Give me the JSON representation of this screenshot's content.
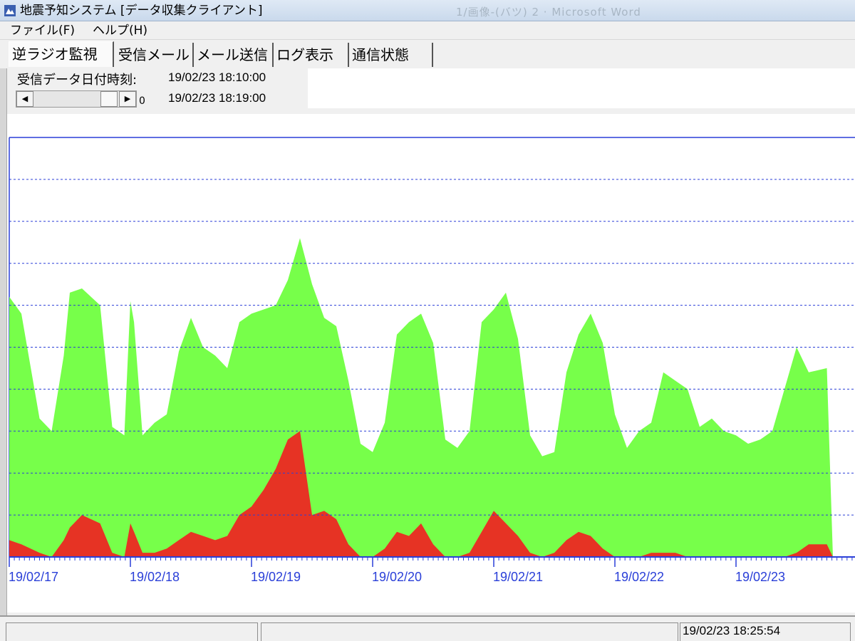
{
  "window": {
    "title": "地震予知システム [データ収集クライアント]",
    "background_title": "1/画像-(バツ) 2 · Microsoft Word"
  },
  "menu": {
    "file": "ファイル(F)",
    "help": "ヘルプ(H)"
  },
  "tabs": [
    {
      "label": "逆ラジオ監視",
      "active": true
    },
    {
      "label": "受信メール",
      "active": false
    },
    {
      "label": "メール送信",
      "active": false
    },
    {
      "label": "ログ表示",
      "active": false
    },
    {
      "label": "通信状態",
      "active": false
    }
  ],
  "info": {
    "recv_label": "受信データ日付時刻:",
    "recv_time1": "19/02/23 18:10:00",
    "recv_time2": "19/02/23 18:19:00",
    "scroll_value": "0"
  },
  "status": {
    "timestamp": "19/02/23 18:25:54"
  },
  "colors": {
    "green_series": "#77ff4a",
    "red_series": "#e63324",
    "axis": "#2a3fd8",
    "grid": "#2a3fd8"
  },
  "chart_data": {
    "type": "area",
    "x_ticks": [
      "19/02/17",
      "19/02/18",
      "19/02/19",
      "19/02/20",
      "19/02/21",
      "19/02/22",
      "19/02/23"
    ],
    "grid": true,
    "grid_style": "dashed",
    "ylim": [
      0,
      10
    ],
    "series": [
      {
        "color": "#77ff4a",
        "x": [
          0,
          0.1,
          0.25,
          0.35,
          0.45,
          0.5,
          0.6,
          0.75,
          0.85,
          0.95,
          1.0,
          1.03,
          1.1,
          1.2,
          1.3,
          1.4,
          1.5,
          1.6,
          1.7,
          1.8,
          1.9,
          2.0,
          2.1,
          2.2,
          2.3,
          2.4,
          2.5,
          2.6,
          2.7,
          2.8,
          2.9,
          3.0,
          3.1,
          3.2,
          3.3,
          3.4,
          3.5,
          3.6,
          3.7,
          3.8,
          3.9,
          4.0,
          4.1,
          4.2,
          4.3,
          4.4,
          4.5,
          4.6,
          4.7,
          4.8,
          4.9,
          5.0,
          5.1,
          5.2,
          5.3,
          5.4,
          5.5,
          5.6,
          5.7,
          5.8,
          5.9,
          6.0,
          6.1,
          6.2,
          6.3,
          6.4,
          6.5,
          6.6,
          6.75,
          6.8
        ],
        "values": [
          6.2,
          5.8,
          3.3,
          3.0,
          4.8,
          6.3,
          6.4,
          6.0,
          3.1,
          2.9,
          6.1,
          5.6,
          2.9,
          3.2,
          3.4,
          4.9,
          5.7,
          5.0,
          4.8,
          4.5,
          5.6,
          5.8,
          5.9,
          6.0,
          6.6,
          7.6,
          6.5,
          5.7,
          5.5,
          4.2,
          2.7,
          2.5,
          3.2,
          5.3,
          5.6,
          5.8,
          5.1,
          2.8,
          2.6,
          3.0,
          5.6,
          5.9,
          6.3,
          5.2,
          2.9,
          2.4,
          2.5,
          4.4,
          5.3,
          5.8,
          5.1,
          3.4,
          2.6,
          3.0,
          3.2,
          4.4,
          4.2,
          4.0,
          3.1,
          3.3,
          3.0,
          2.9,
          2.7,
          2.8,
          3.0,
          4.0,
          5.0,
          4.4,
          4.5,
          0
        ]
      },
      {
        "color": "#e63324",
        "x": [
          0,
          0.1,
          0.25,
          0.35,
          0.45,
          0.5,
          0.6,
          0.75,
          0.85,
          0.95,
          1.0,
          1.03,
          1.1,
          1.2,
          1.3,
          1.4,
          1.5,
          1.6,
          1.7,
          1.8,
          1.9,
          2.0,
          2.1,
          2.2,
          2.3,
          2.4,
          2.5,
          2.6,
          2.7,
          2.8,
          2.9,
          3.0,
          3.1,
          3.2,
          3.3,
          3.4,
          3.5,
          3.6,
          3.7,
          3.8,
          3.9,
          4.0,
          4.1,
          4.2,
          4.3,
          4.4,
          4.5,
          4.6,
          4.7,
          4.8,
          4.9,
          5.0,
          5.1,
          5.2,
          5.3,
          5.4,
          5.5,
          5.6,
          5.7,
          5.8,
          5.9,
          6.0,
          6.1,
          6.2,
          6.3,
          6.4,
          6.5,
          6.6,
          6.75,
          6.8
        ],
        "values": [
          0.4,
          0.3,
          0.1,
          0.0,
          0.4,
          0.7,
          1.0,
          0.8,
          0.1,
          0.0,
          0.8,
          0.6,
          0.1,
          0.1,
          0.2,
          0.4,
          0.6,
          0.5,
          0.4,
          0.5,
          1.0,
          1.2,
          1.6,
          2.1,
          2.8,
          3.0,
          1.0,
          1.1,
          0.9,
          0.3,
          0.0,
          0.0,
          0.2,
          0.6,
          0.5,
          0.8,
          0.3,
          0.0,
          0.0,
          0.1,
          0.6,
          1.1,
          0.8,
          0.5,
          0.1,
          0.0,
          0.1,
          0.4,
          0.6,
          0.5,
          0.2,
          0.0,
          0.0,
          0.0,
          0.1,
          0.1,
          0.1,
          0.0,
          0.0,
          0.0,
          0.0,
          0.0,
          0.0,
          0.0,
          0.0,
          0.0,
          0.1,
          0.3,
          0.3,
          0.0
        ]
      }
    ]
  }
}
